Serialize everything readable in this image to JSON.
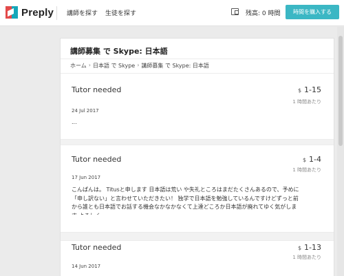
{
  "header": {
    "logo_text": "Preply",
    "nav": [
      "講師を探す",
      "生徒を探す"
    ],
    "balance": "残高: 0 時間",
    "buy_button": "時間を購入する"
  },
  "page": {
    "title": "講師募集 で Skype: 日本語",
    "breadcrumb": [
      "ホーム",
      "日本語 で Skype",
      "講師募集 で Skype: 日本語"
    ],
    "breadcrumb_separator": "›"
  },
  "listings": [
    {
      "title": "Tutor needed",
      "currency": "$",
      "price": "1-15",
      "per_hour": "1 時間あたり",
      "date": "24 Jul 2017",
      "description": "..."
    },
    {
      "title": "Tutor needed",
      "currency": "$",
      "price": "1-4",
      "per_hour": "1 時間あたり",
      "date": "17 Jun 2017",
      "description": "こんぱんは。 Titusと申します 日本語は荒い や失礼ところはまだたくさんあるので、予めに「申し訳ない」と言わせていただきたい！ 独学で日本語を勉強しているんですけどずっと前から誰とも日本語でお話する機会なかなかなくて上達どころか日本語が廃れてゆく気がします よろしく"
    },
    {
      "title": "Tutor needed",
      "currency": "$",
      "price": "1-13",
      "per_hour": "1 時間あたり",
      "date": "14 Jun 2017",
      "description": ""
    }
  ]
}
